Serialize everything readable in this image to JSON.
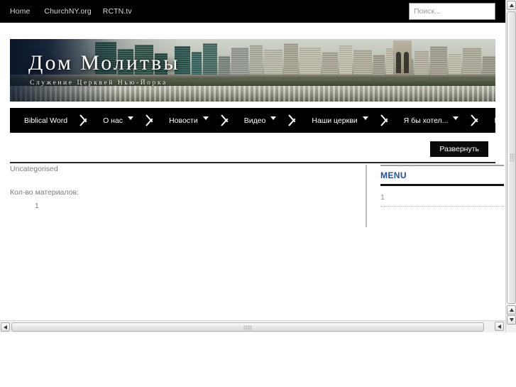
{
  "topbar": {
    "links": [
      {
        "label": "Home",
        "name": "top-link-home"
      },
      {
        "label": "ChurchNY.org",
        "name": "top-link-churchny"
      },
      {
        "label": "RCTN.tv",
        "name": "top-link-rctntv"
      }
    ],
    "search": {
      "placeholder": "Поиск...",
      "value": ""
    },
    "background": "#000000"
  },
  "banner": {
    "title": "Дом Молитвы",
    "subtitle": "Служение Церквей Нью-Йорка",
    "image_alt": "new-york-skyline-brooklyn-bridge"
  },
  "mainnav": {
    "items": [
      {
        "label": "Biblical Word",
        "has_dropdown": false
      },
      {
        "label": "О нас",
        "has_dropdown": true
      },
      {
        "label": "Новости",
        "has_dropdown": true
      },
      {
        "label": "Видео",
        "has_dropdown": true
      },
      {
        "label": "Наши церкви",
        "has_dropdown": true
      },
      {
        "label": "Я бы хотел...",
        "has_dropdown": true
      },
      {
        "label": "Приглашаем к партнерству!",
        "has_dropdown": true
      }
    ],
    "background": "#000000"
  },
  "toolbar": {
    "expand_label": "Развернуть"
  },
  "content": {
    "category_title": "Uncategorised",
    "count_label": "Кол-во материалов:",
    "count_value": "1"
  },
  "sidebar": {
    "title": "MENU",
    "title_color": "#1f4fa8",
    "items": [
      {
        "label": "1"
      }
    ]
  }
}
